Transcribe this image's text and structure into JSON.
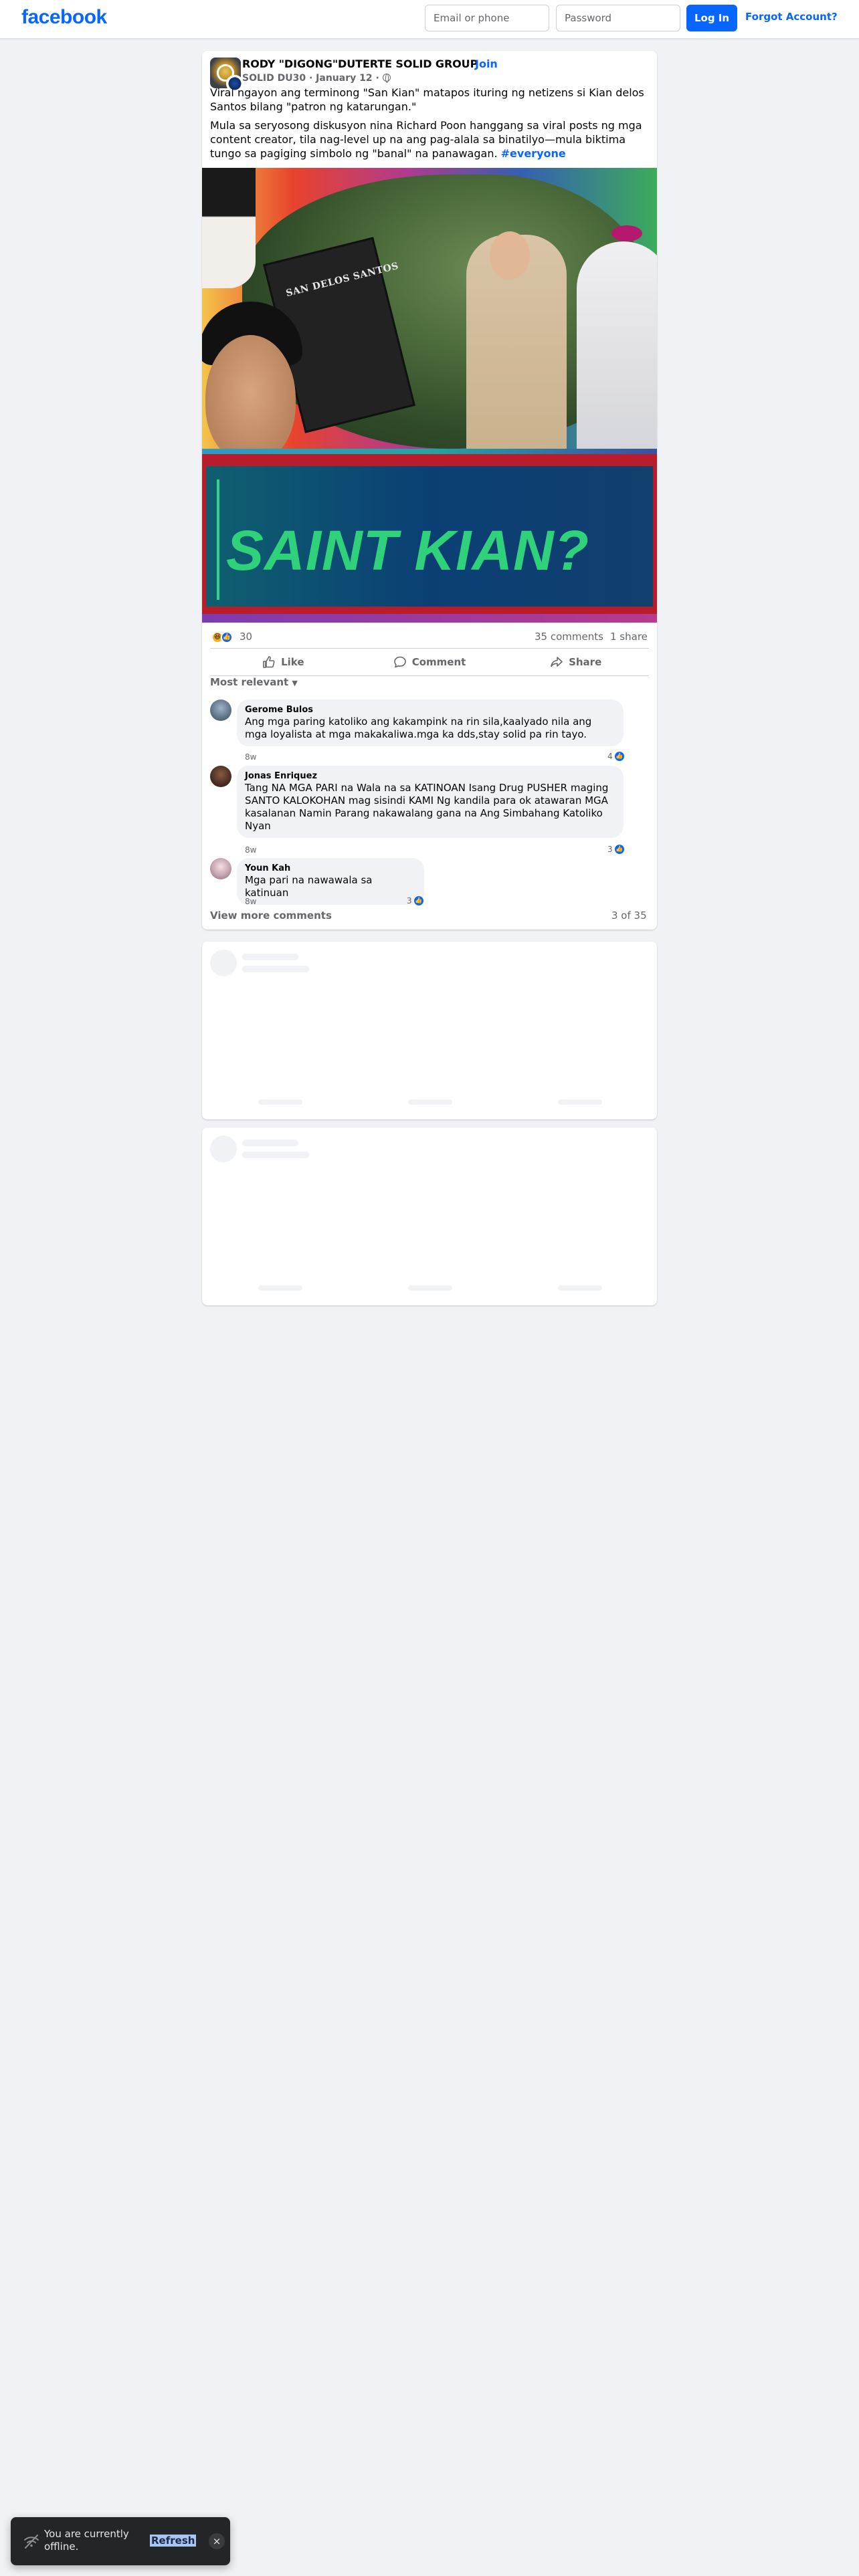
{
  "header": {
    "logo": "facebook",
    "email_placeholder": "Email or phone",
    "password_placeholder": "Password",
    "login_label": "Log In",
    "forgot_label": "Forgot Account?"
  },
  "post": {
    "group_name": "RODY \"DIGONG\"DUTERTE SOLID GROUP",
    "join_label": "Join",
    "author": "SOLID DU30",
    "date": "January 12",
    "text_p1": "Viral ngayon ang terminong \"San Kian\" matapos ituring ng netizens si Kian delos Santos bilang \"patron ng katarungan.\"",
    "text_p2": "Mula sa seryosong diskusyon nina Richard Poon hanggang sa viral posts ng mga content creator, tila nag-level up na ang pag-alala sa binatilyo—mula biktima tungo sa pagiging simbolo ng \"banal\" na panawagan.",
    "hashtag": "#everyone",
    "image": {
      "plaque_text": "SAN DELOS SANTOS",
      "banner_text": "SAINT KIAN?"
    },
    "reaction_count": "30",
    "comments_count": "35 comments",
    "shares_count": "1 share",
    "actions": {
      "like": "Like",
      "comment": "Comment",
      "share": "Share"
    },
    "sort_label": "Most relevant",
    "comments": [
      {
        "author": "Gerome Bulos",
        "text": "Ang mga paring katoliko ang kakampink na rin sila,kaalyado nila ang mga loyalista at mga makakaliwa.mga ka dds,stay solid pa rin tayo.",
        "time": "8w",
        "likes": "4"
      },
      {
        "author": "Jonas Enriquez",
        "text": "Tang NA MGA PARI na Wala na sa KATINOAN Isang Drug PUSHER maging SANTO KALOKOHAN mag sisindi KAMI Ng kandila para ok atawaran MGA kasalanan Namin Parang nakawalang gana na Ang Simbahang Katoliko Nyan",
        "time": "8w",
        "likes": "3"
      },
      {
        "author": "Youn Kah",
        "text": "Mga pari na nawawala sa katinuan",
        "time": "8w",
        "likes": "3"
      }
    ],
    "view_more": "View more comments",
    "pager": "3 of 35"
  },
  "toast": {
    "message": "You are currently offline.",
    "refresh_label": "Refresh",
    "close_glyph": "×"
  },
  "icons": {
    "like": "thumbs-up-icon",
    "comment": "speech-bubble-icon",
    "share": "share-arrow-icon",
    "globe": "globe-icon",
    "wifi_off": "wifi-off-icon"
  },
  "colors": {
    "brand": "#0866ff",
    "page_bg": "#f0f2f5",
    "muted_text": "#65676b",
    "toast_bg": "#242526",
    "banner_green": "#2fd27b",
    "banner_red": "#b91c2b"
  }
}
